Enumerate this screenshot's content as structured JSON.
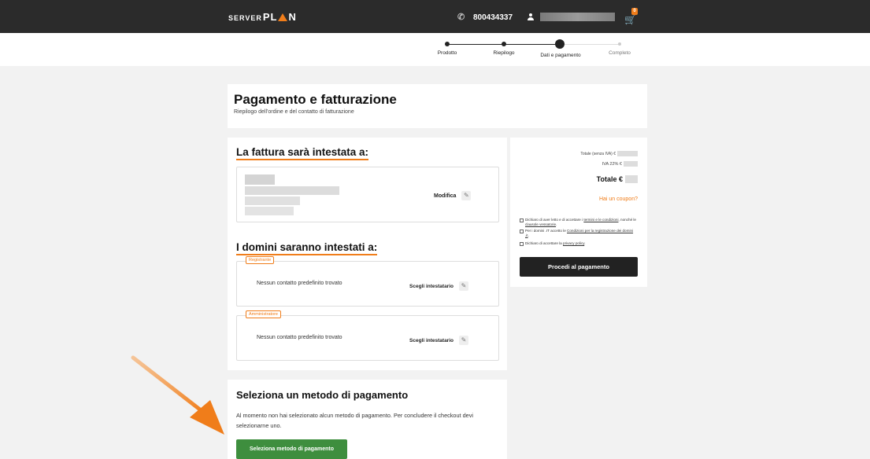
{
  "header": {
    "logo_small": "SERVER",
    "logo_big_1": "PL",
    "logo_big_2": "N",
    "phone": "800434337",
    "cart_count": "0"
  },
  "steps": [
    {
      "label": "Prodotto",
      "state": "done"
    },
    {
      "label": "Riepilogo",
      "state": "done"
    },
    {
      "label": "Dati e pagamento",
      "state": "current"
    },
    {
      "label": "Completo",
      "state": "pending"
    }
  ],
  "page": {
    "title": "Pagamento e fatturazione",
    "subtitle": "Riepilogo dell'ordine e del contatto di fatturazione"
  },
  "billing": {
    "heading": "La fattura sarà intestata a:",
    "edit_label": "Modifica"
  },
  "domains": {
    "heading": "I domini saranno intestati a:",
    "blocks": [
      {
        "tag": "Registrante",
        "empty_text": "Nessun contatto predefinito trovato",
        "action": "Scegli intestatario"
      },
      {
        "tag": "Amministratore",
        "empty_text": "Nessun contatto predefinito trovato",
        "action": "Scegli intestatario"
      }
    ]
  },
  "summary": {
    "subtotal_label": "Totale (senza IVA) €",
    "vat_label": "IVA 22% €",
    "total_label": "Totale €",
    "coupon_label": "Hai un coupon?",
    "checks": [
      {
        "pre": "Dichiaro di aver letto e di accettare i ",
        "link": "termini e le condizioni",
        "mid": ", nonché le ",
        "link2": "clausole vessatorie",
        "post": "."
      },
      {
        "pre": "Per i domini .IT accetto le ",
        "link": "Condizioni per la registrazione dei domini .it",
        "mid": "",
        "link2": "",
        "post": "."
      },
      {
        "pre": "Dichiaro di accettare la ",
        "link": "privacy policy",
        "mid": "",
        "link2": "",
        "post": "."
      }
    ],
    "proceed_label": "Procedi al pagamento"
  },
  "payment": {
    "title": "Seleziona un metodo di pagamento",
    "text": "Al momento non hai selezionato alcun metodo di pagamento. Per concludere il checkout devi selezionarne uno.",
    "button_label": "Seleziona metodo di pagamento"
  },
  "colors": {
    "accent": "#f07d1a",
    "topbar": "#2b2b2b",
    "pay_button": "#3e8e3e",
    "proceed_button": "#222222"
  }
}
